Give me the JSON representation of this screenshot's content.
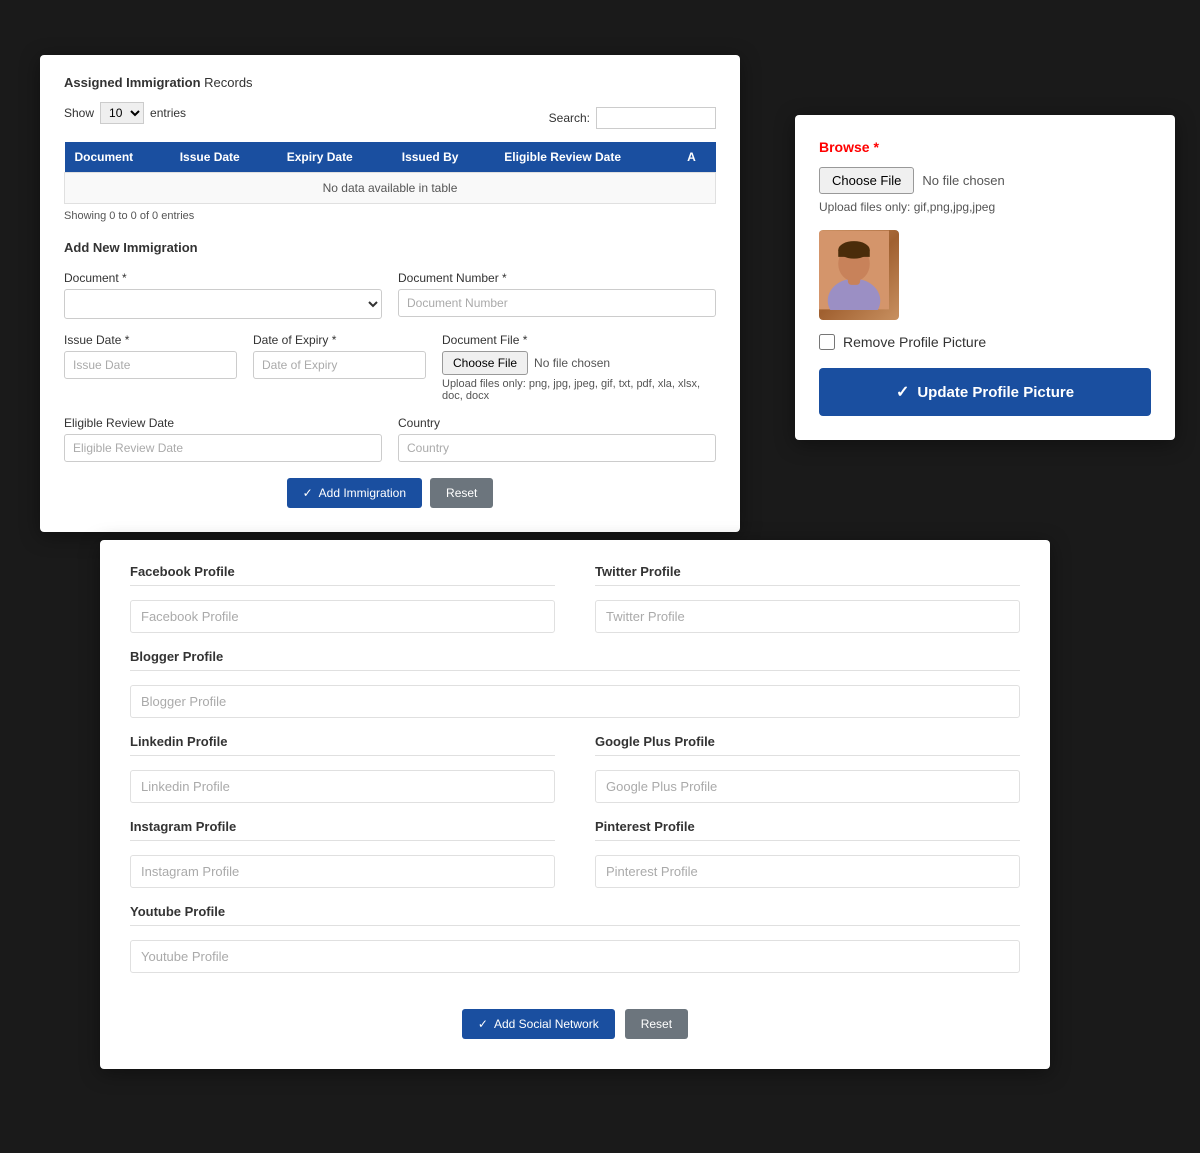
{
  "immigration": {
    "section_title_bold": "Assigned Immigration",
    "section_title_normal": " Records",
    "show_label": "Show",
    "entries_label": "entries",
    "show_value": "10",
    "search_label": "Search:",
    "table": {
      "headers": [
        "Document",
        "Issue Date",
        "Expiry Date",
        "Issued By",
        "Eligible Review Date",
        "A"
      ],
      "no_data": "No data available in table",
      "showing": "Showing 0 to 0 of 0 entries"
    },
    "add_new_title": "Add New Immigration",
    "form": {
      "document_label": "Document *",
      "document_number_label": "Document Number *",
      "document_number_placeholder": "Document Number",
      "issue_date_label": "Issue Date *",
      "issue_date_placeholder": "Issue Date",
      "date_of_expiry_label": "Date of Expiry *",
      "date_of_expiry_placeholder": "Date of Expiry",
      "document_file_label": "Document File *",
      "document_file_choose": "Choose File",
      "document_file_no_file": "No file chosen",
      "document_file_hint": "Upload files only: png, jpg, jpeg, gif, txt, pdf, xla, xlsx, doc, docx",
      "eligible_review_label": "Eligible Review Date",
      "eligible_review_placeholder": "Eligible Review Date",
      "country_label": "Country",
      "country_placeholder": "Country",
      "add_btn": "Add Immigration",
      "reset_btn": "Reset"
    }
  },
  "profile": {
    "browse_label": "Browse",
    "browse_star": "*",
    "choose_btn": "Choose File",
    "no_file": "No file chosen",
    "upload_hint": "Upload files only: gif,png,jpg,jpeg",
    "remove_label": "Remove Profile Picture",
    "update_btn": "Update Profile Picture"
  },
  "social": {
    "fields": [
      {
        "label": "Facebook Profile",
        "placeholder": "Facebook Profile",
        "col": "left"
      },
      {
        "label": "Twitter Profile",
        "placeholder": "Twitter Profile",
        "col": "right"
      },
      {
        "label": "Blogger Profile",
        "placeholder": "Blogger Profile",
        "col": "full"
      },
      {
        "label": "Linkedin Profile",
        "placeholder": "Linkedin Profile",
        "col": "left"
      },
      {
        "label": "Google Plus Profile",
        "placeholder": "Google Plus Profile",
        "col": "right"
      },
      {
        "label": "Instagram Profile",
        "placeholder": "Instagram Profile",
        "col": "left"
      },
      {
        "label": "Pinterest Profile",
        "placeholder": "Pinterest Profile",
        "col": "right"
      },
      {
        "label": "Youtube Profile",
        "placeholder": "Youtube Profile",
        "col": "full"
      }
    ],
    "add_btn": "Add Social Network",
    "reset_btn": "Reset"
  }
}
